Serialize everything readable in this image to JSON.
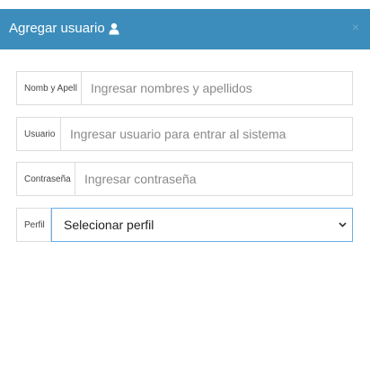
{
  "modal": {
    "title": "Agregar usuario",
    "close_glyph": "×",
    "header_color": "#3c8dbc",
    "title_icon": "user-icon"
  },
  "form": {
    "fullname": {
      "label": "Nomb y Apell",
      "placeholder": "Ingresar nombres y apellidos"
    },
    "username": {
      "label": "Usuario",
      "placeholder": "Ingresar usuario para entrar al sistema"
    },
    "password": {
      "label": "Contraseña",
      "placeholder": "Ingresar contraseña"
    },
    "profile": {
      "label": "Perfil",
      "selected": "Selecionar perfil"
    }
  }
}
